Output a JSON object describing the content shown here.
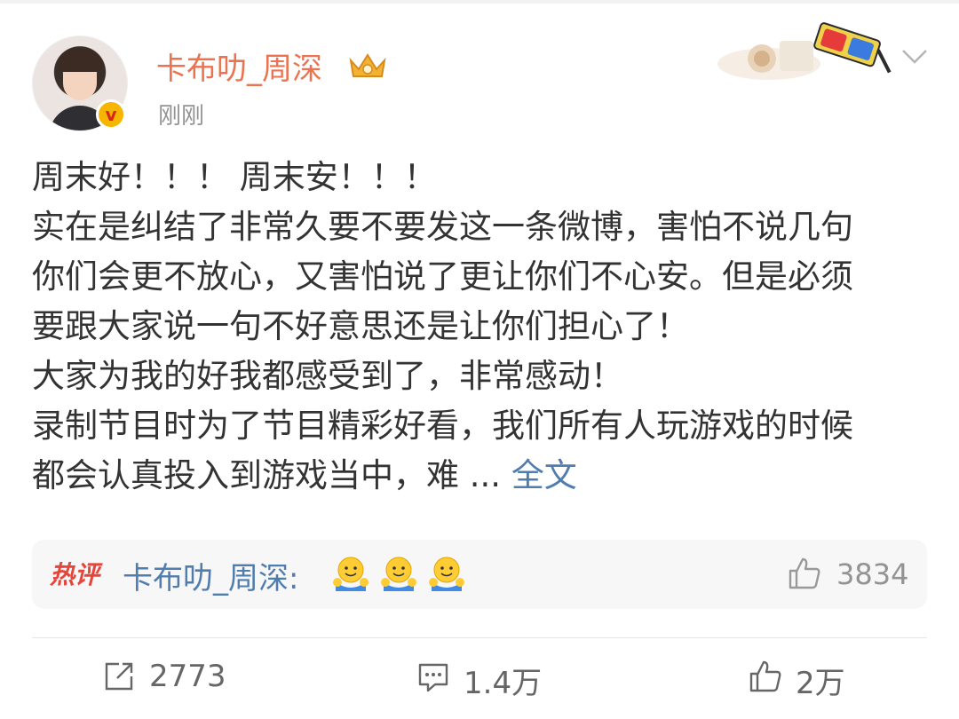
{
  "post": {
    "username": "卡布叻_周深",
    "timestamp": "刚刚",
    "verified_icon": "v-verified-badge",
    "crown_icon": "crown-icon",
    "content_lines": [
      "周末好！！！ 周末安！！！",
      "实在是纠结了非常久要不要发这一条微博，害怕不说几句",
      "你们会更不放心，又害怕说了更让你们不心安。但是必须",
      "要跟大家说一句不好意思还是让你们担心了！",
      "大家为我的好我都感受到了，非常感动！",
      "录制节目时为了节目精彩好看，我们所有人玩游戏的时候",
      "都会认真投入到游戏当中，难 ..."
    ],
    "more_link": "全文"
  },
  "hot_comment": {
    "tag": "热评",
    "user": "卡布叻_周深:",
    "emojis": [
      "hug-emoji",
      "hug-emoji",
      "hug-emoji"
    ],
    "like_count": "3834"
  },
  "actions": {
    "repost_count": "2773",
    "comment_count": "1.4万",
    "like_count": "2万"
  },
  "colors": {
    "username": "#eb7350",
    "link": "#507daf",
    "muted": "#939393",
    "hot_tag": "#e5453a"
  }
}
